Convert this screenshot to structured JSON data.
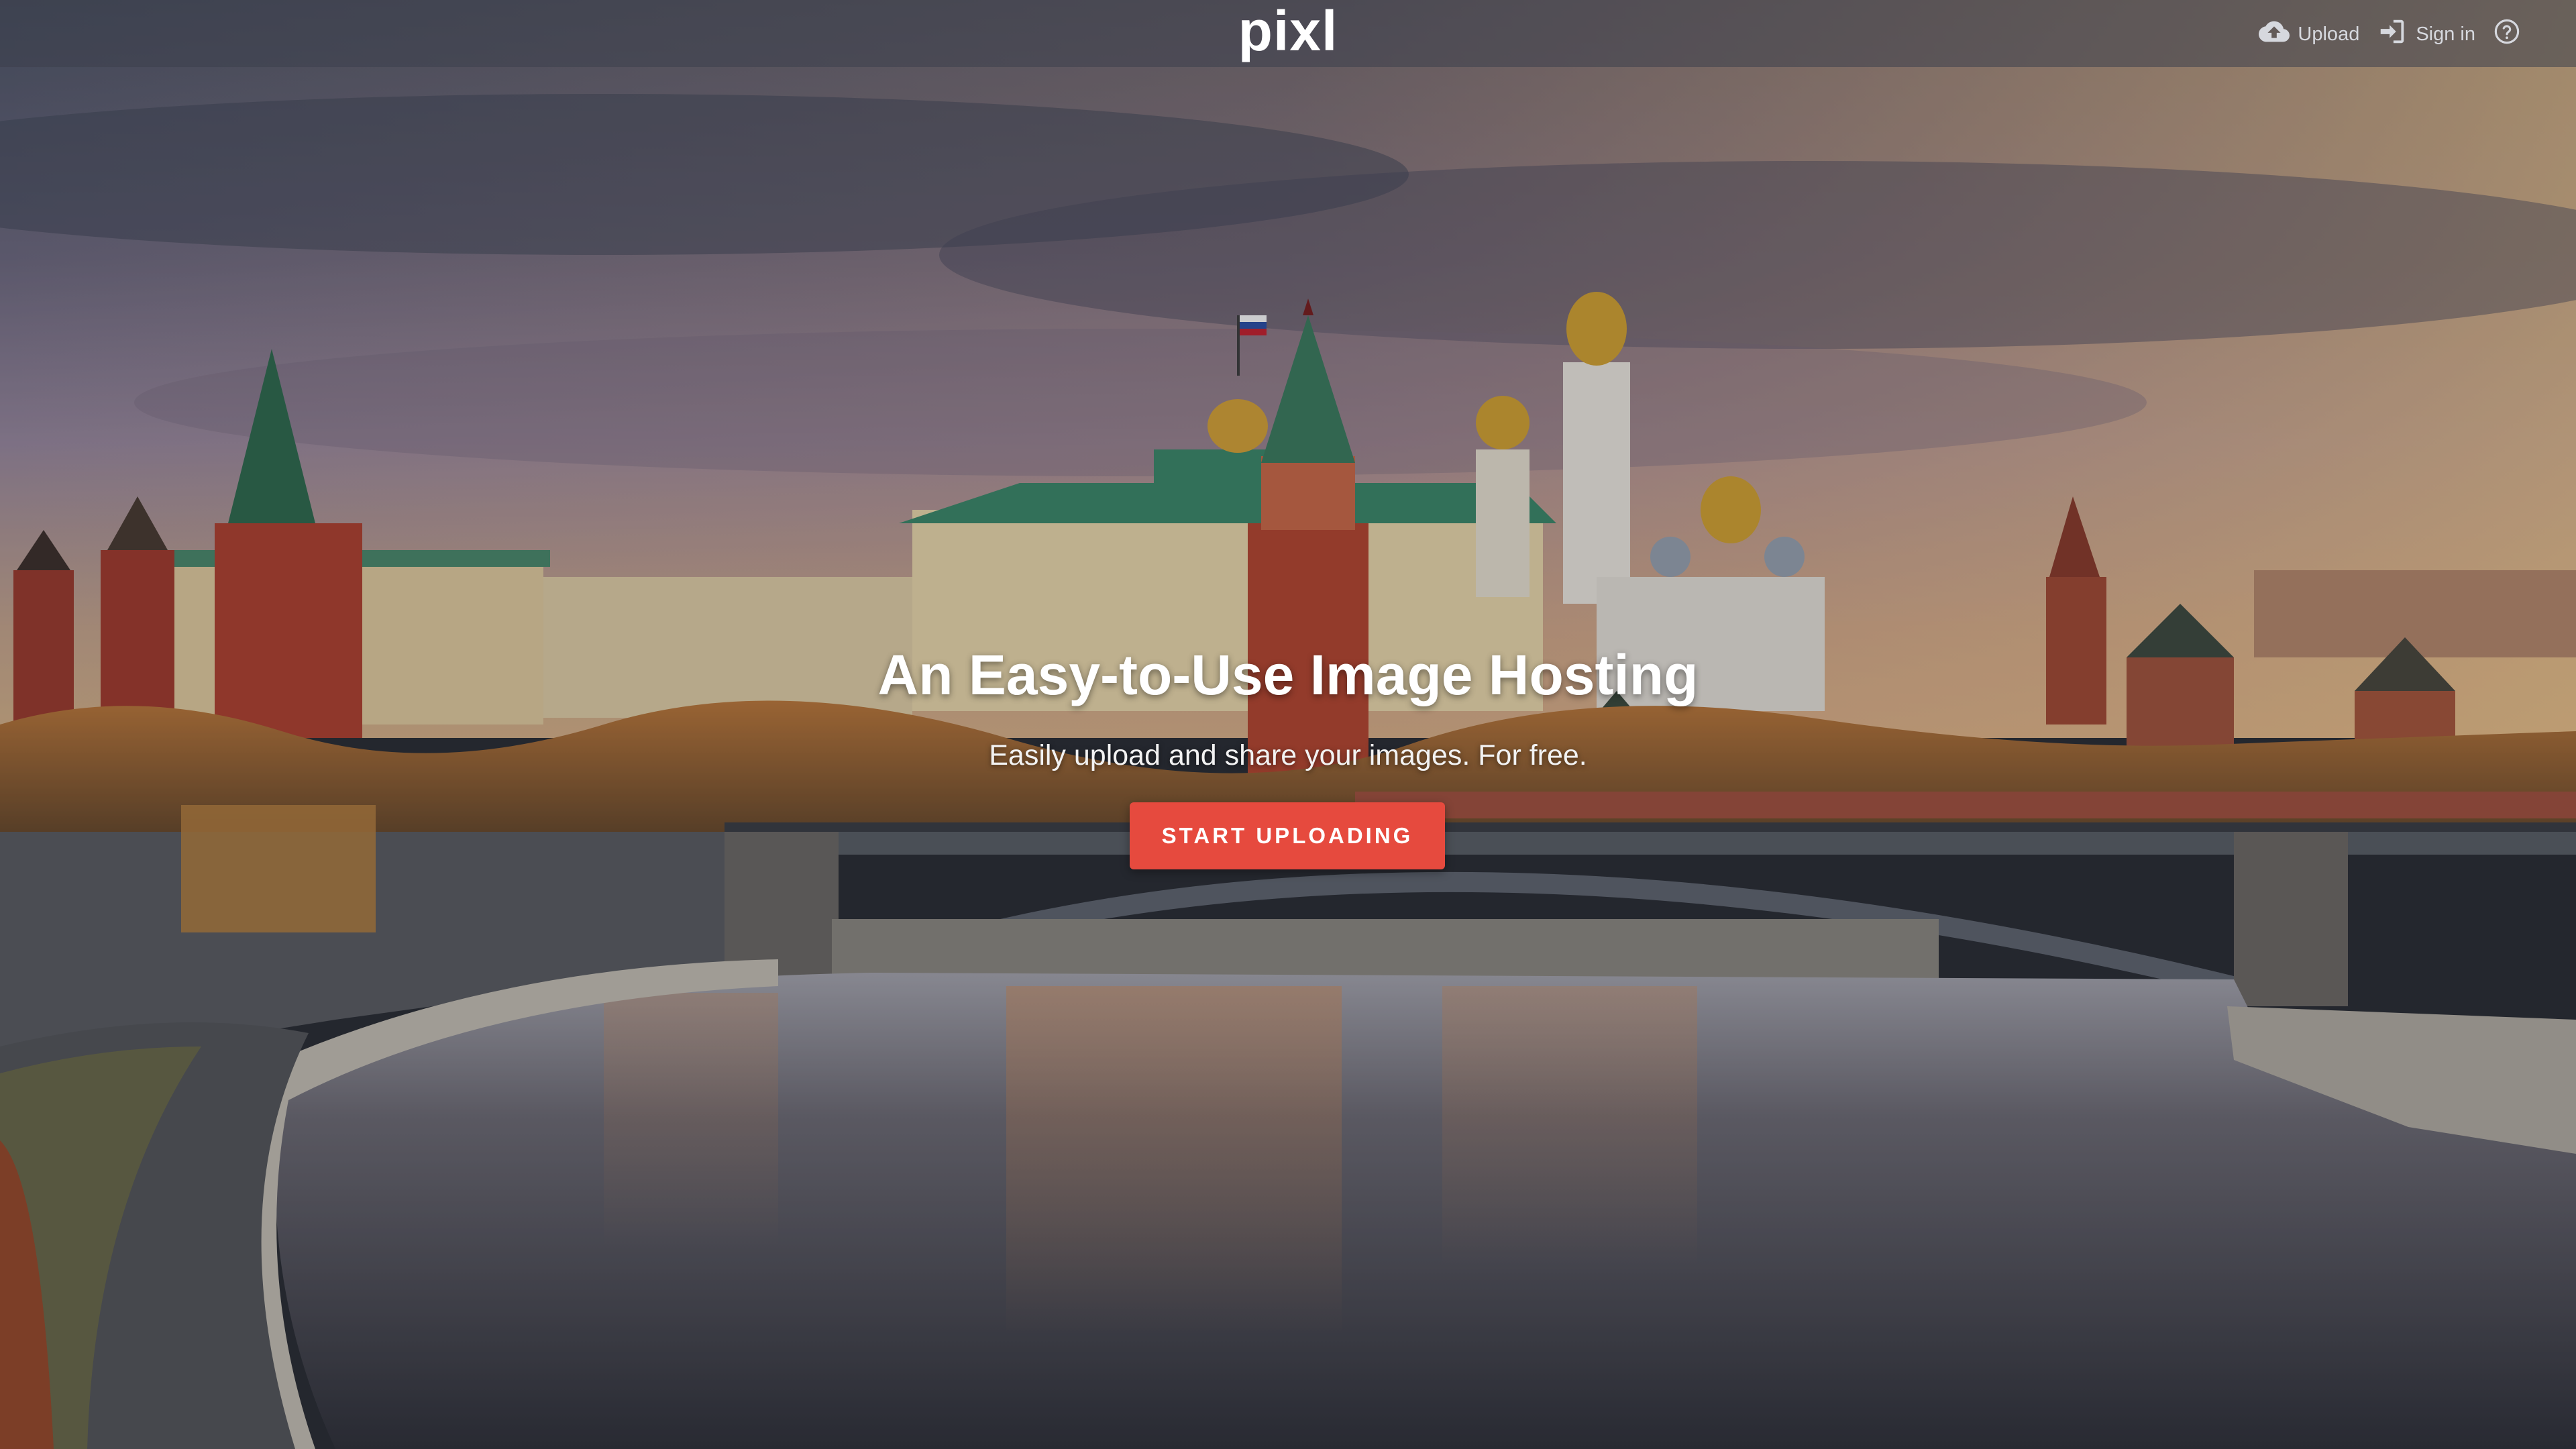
{
  "brand": {
    "name": "pixl"
  },
  "nav": {
    "upload_label": "Upload",
    "signin_label": "Sign in",
    "upload_icon": "cloud-upload-icon",
    "signin_icon": "sign-in-icon",
    "help_icon": "help-circle-icon"
  },
  "hero": {
    "headline": "An Easy-to-Use Image Hosting",
    "subline": "Easily upload and share your images. For free.",
    "cta_label": "START UPLOADING",
    "background": "photo-moscow-kremlin-river-at-sunset"
  },
  "colors": {
    "accent": "#e64a3e",
    "topbar": "#3c404c",
    "text": "#ffffff"
  }
}
